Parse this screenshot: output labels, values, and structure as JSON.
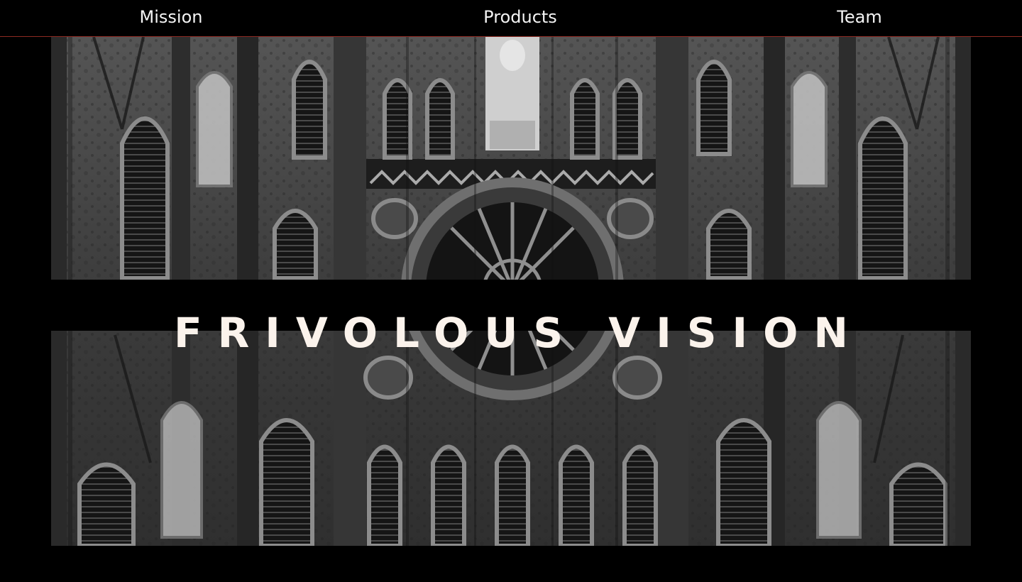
{
  "nav": {
    "items": [
      {
        "label": "Mission"
      },
      {
        "label": "Products"
      },
      {
        "label": "Team"
      }
    ],
    "border_color": "#8e2a22"
  },
  "hero": {
    "title": "FRIVOLOUS VISION",
    "image_subject": "gothic-cathedral-facade",
    "image_tone": "black-and-white"
  },
  "colors": {
    "background": "#000000",
    "nav_text": "#f4f4f4",
    "title_text": "#fbf3ec"
  }
}
